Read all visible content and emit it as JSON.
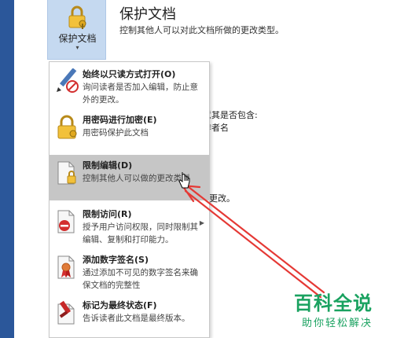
{
  "protect": {
    "button_label": "保护文档",
    "caret": "▾",
    "title": "保护文档",
    "description": "控制其他人可以对此文档所做的更改类型。"
  },
  "background_fragments": {
    "line1": "意其是否包含:",
    "line2": "作者名",
    "line3": "更改。"
  },
  "menu": {
    "items": [
      {
        "title": "始终以只读方式打开(O)",
        "desc": "询问读者是否加入编辑，防止意外的更改。",
        "icon": "pencil-no-icon"
      },
      {
        "title": "用密码进行加密(E)",
        "desc": "用密码保护此文档",
        "icon": "lock-icon"
      },
      {
        "title": "限制编辑(D)",
        "desc": "控制其他人可以做的更改类型",
        "icon": "document-lock-icon"
      },
      {
        "title": "限制访问(R)",
        "desc": "授予用户访问权限，同时限制其编辑、复制和打印能力。",
        "icon": "restrict-access-icon",
        "submenu_arrow": "▶"
      },
      {
        "title": "添加数字签名(S)",
        "desc": "通过添加不可见的数字签名来确保文档的完整性",
        "icon": "signature-ribbon-icon"
      },
      {
        "title": "标记为最终状态(F)",
        "desc": "告诉读者此文档是最终版本。",
        "icon": "mark-final-icon"
      }
    ],
    "hovered_index": 2
  },
  "watermark": {
    "brand": "百科全说",
    "slogan": "助你轻松解决"
  },
  "colors": {
    "accent_blue": "#2b579a",
    "hover_gray": "#c6c6c6",
    "annotation_red": "#e53935",
    "watermark_green": "#1aa260"
  }
}
